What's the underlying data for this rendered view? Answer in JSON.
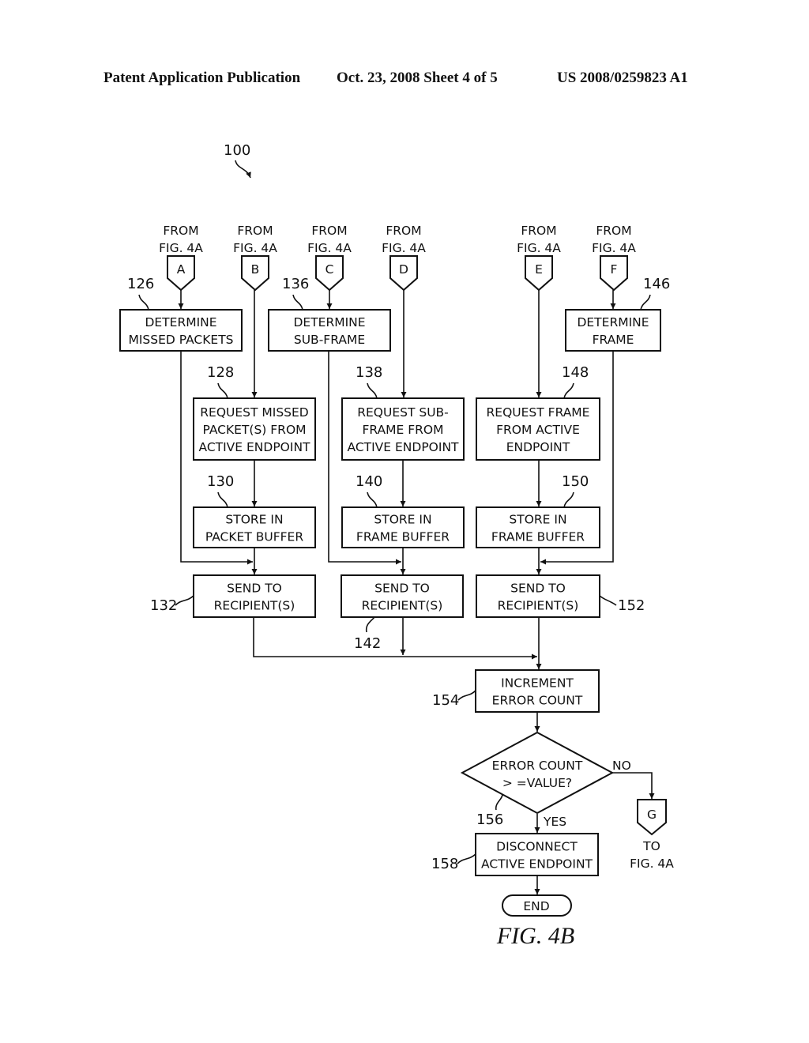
{
  "header": {
    "publication": "Patent Application Publication",
    "date_sheet": "Oct. 23, 2008   Sheet 4 of 5",
    "patent_number": "US 2008/0259823 A1"
  },
  "figure": {
    "reference": "100",
    "caption": "FIG. 4B"
  },
  "connectors_in": [
    {
      "letter": "A",
      "label1": "FROM",
      "label2": "FIG. 4A"
    },
    {
      "letter": "B",
      "label1": "FROM",
      "label2": "FIG. 4A"
    },
    {
      "letter": "C",
      "label1": "FROM",
      "label2": "FIG. 4A"
    },
    {
      "letter": "D",
      "label1": "FROM",
      "label2": "FIG. 4A"
    },
    {
      "letter": "E",
      "label1": "FROM",
      "label2": "FIG. 4A"
    },
    {
      "letter": "F",
      "label1": "FROM",
      "label2": "FIG. 4A"
    }
  ],
  "connector_out": {
    "letter": "G",
    "label1": "TO",
    "label2": "FIG. 4A"
  },
  "steps": {
    "s126": {
      "ref": "126",
      "lines": [
        "DETERMINE",
        "MISSED PACKETS"
      ]
    },
    "s136": {
      "ref": "136",
      "lines": [
        "DETERMINE",
        "SUB-FRAME"
      ]
    },
    "s146": {
      "ref": "146",
      "lines": [
        "DETERMINE",
        "FRAME"
      ]
    },
    "s128": {
      "ref": "128",
      "lines": [
        "REQUEST MISSED",
        "PACKET(S) FROM",
        "ACTIVE ENDPOINT"
      ]
    },
    "s138": {
      "ref": "138",
      "lines": [
        "REQUEST SUB-",
        "FRAME FROM",
        "ACTIVE ENDPOINT"
      ]
    },
    "s148": {
      "ref": "148",
      "lines": [
        "REQUEST FRAME",
        "FROM ACTIVE",
        "ENDPOINT"
      ]
    },
    "s130": {
      "ref": "130",
      "lines": [
        "STORE IN",
        "PACKET BUFFER"
      ]
    },
    "s140": {
      "ref": "140",
      "lines": [
        "STORE IN",
        "FRAME BUFFER"
      ]
    },
    "s150": {
      "ref": "150",
      "lines": [
        "STORE IN",
        "FRAME BUFFER"
      ]
    },
    "s132": {
      "ref": "132",
      "lines": [
        "SEND TO",
        "RECIPIENT(S)"
      ]
    },
    "s142": {
      "ref": "142",
      "lines": [
        "SEND TO",
        "RECIPIENT(S)"
      ]
    },
    "s152": {
      "ref": "152",
      "lines": [
        "SEND TO",
        "RECIPIENT(S)"
      ]
    },
    "s154": {
      "ref": "154",
      "lines": [
        "INCREMENT",
        "ERROR COUNT"
      ]
    },
    "s156": {
      "ref": "156",
      "lines": [
        "ERROR COUNT",
        "> =VALUE?"
      ],
      "yes": "YES",
      "no": "NO"
    },
    "s158": {
      "ref": "158",
      "lines": [
        "DISCONNECT",
        "ACTIVE ENDPOINT"
      ]
    },
    "end": {
      "lines": [
        "END"
      ]
    }
  }
}
